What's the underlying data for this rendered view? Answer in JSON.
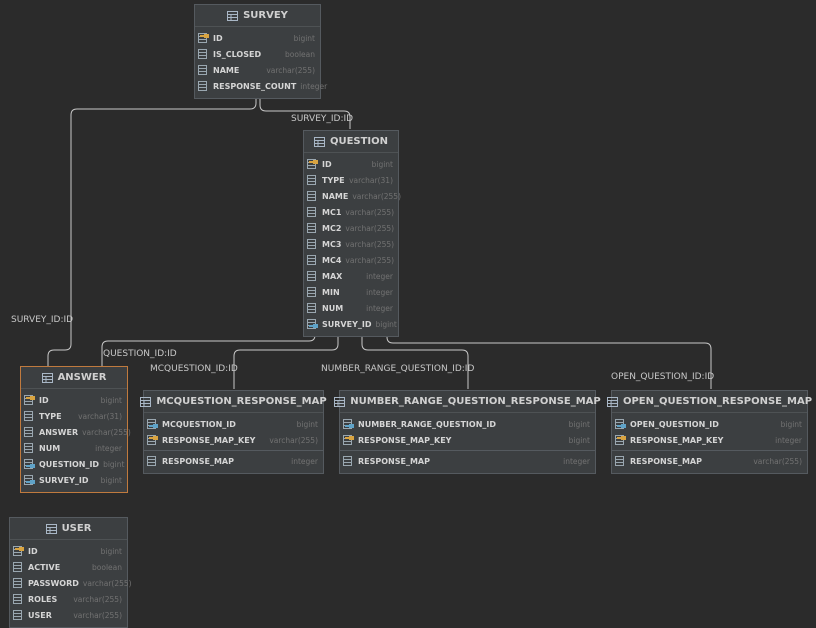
{
  "tables": {
    "survey": {
      "name": "SURVEY",
      "columns": [
        {
          "name": "ID",
          "type": "bigint",
          "icon": "primary-key-column-icon"
        },
        {
          "name": "IS_CLOSED",
          "type": "boolean",
          "icon": "column-icon"
        },
        {
          "name": "NAME",
          "type": "varchar(255)",
          "icon": "column-icon"
        },
        {
          "name": "RESPONSE_COUNT",
          "type": "integer",
          "icon": "column-icon"
        }
      ]
    },
    "question": {
      "name": "QUESTION",
      "columns": [
        {
          "name": "ID",
          "type": "bigint",
          "icon": "primary-key-column-icon"
        },
        {
          "name": "TYPE",
          "type": "varchar(31)",
          "icon": "column-icon"
        },
        {
          "name": "NAME",
          "type": "varchar(255)",
          "icon": "column-icon"
        },
        {
          "name": "MC1",
          "type": "varchar(255)",
          "icon": "column-icon"
        },
        {
          "name": "MC2",
          "type": "varchar(255)",
          "icon": "column-icon"
        },
        {
          "name": "MC3",
          "type": "varchar(255)",
          "icon": "column-icon"
        },
        {
          "name": "MC4",
          "type": "varchar(255)",
          "icon": "column-icon"
        },
        {
          "name": "MAX",
          "type": "integer",
          "icon": "column-icon"
        },
        {
          "name": "MIN",
          "type": "integer",
          "icon": "column-icon"
        },
        {
          "name": "NUM",
          "type": "integer",
          "icon": "column-icon"
        },
        {
          "name": "SURVEY_ID",
          "type": "bigint",
          "icon": "foreign-key-column-icon"
        }
      ]
    },
    "answer": {
      "name": "ANSWER",
      "columns": [
        {
          "name": "ID",
          "type": "bigint",
          "icon": "primary-key-column-icon"
        },
        {
          "name": "TYPE",
          "type": "varchar(31)",
          "icon": "column-icon"
        },
        {
          "name": "ANSWER",
          "type": "varchar(255)",
          "icon": "column-icon"
        },
        {
          "name": "NUM",
          "type": "integer",
          "icon": "column-icon"
        },
        {
          "name": "QUESTION_ID",
          "type": "bigint",
          "icon": "foreign-key-column-icon"
        },
        {
          "name": "SURVEY_ID",
          "type": "bigint",
          "icon": "foreign-key-column-icon"
        }
      ]
    },
    "mcq_map": {
      "name": "MCQUESTION_RESPONSE_MAP",
      "columns": [
        {
          "name": "MCQUESTION_ID",
          "type": "bigint",
          "icon": "foreign-key-column-icon"
        },
        {
          "name": "RESPONSE_MAP_KEY",
          "type": "varchar(255)",
          "icon": "primary-key-column-icon"
        }
      ],
      "extra": [
        {
          "name": "RESPONSE_MAP",
          "type": "integer",
          "icon": "column-icon"
        }
      ]
    },
    "nrq_map": {
      "name": "NUMBER_RANGE_QUESTION_RESPONSE_MAP",
      "columns": [
        {
          "name": "NUMBER_RANGE_QUESTION_ID",
          "type": "bigint",
          "icon": "foreign-key-column-icon"
        },
        {
          "name": "RESPONSE_MAP_KEY",
          "type": "bigint",
          "icon": "primary-key-column-icon"
        }
      ],
      "extra": [
        {
          "name": "RESPONSE_MAP",
          "type": "integer",
          "icon": "column-icon"
        }
      ]
    },
    "oq_map": {
      "name": "OPEN_QUESTION_RESPONSE_MAP",
      "columns": [
        {
          "name": "OPEN_QUESTION_ID",
          "type": "bigint",
          "icon": "foreign-key-column-icon"
        },
        {
          "name": "RESPONSE_MAP_KEY",
          "type": "integer",
          "icon": "primary-key-column-icon"
        }
      ],
      "extra": [
        {
          "name": "RESPONSE_MAP",
          "type": "varchar(255)",
          "icon": "column-icon"
        }
      ]
    },
    "user": {
      "name": "USER",
      "columns": [
        {
          "name": "ID",
          "type": "bigint",
          "icon": "primary-key-column-icon"
        },
        {
          "name": "ACTIVE",
          "type": "boolean",
          "icon": "column-icon"
        },
        {
          "name": "PASSWORD",
          "type": "varchar(255)",
          "icon": "column-icon"
        },
        {
          "name": "ROLES",
          "type": "varchar(255)",
          "icon": "column-icon"
        },
        {
          "name": "USER",
          "type": "varchar(255)",
          "icon": "column-icon"
        }
      ]
    }
  },
  "relations": [
    {
      "id": "question-survey",
      "label": "SURVEY_ID:ID"
    },
    {
      "id": "answer-survey",
      "label": "SURVEY_ID:ID"
    },
    {
      "id": "answer-question",
      "label": "QUESTION_ID:ID"
    },
    {
      "id": "mcq-question",
      "label": "MCQUESTION_ID:ID"
    },
    {
      "id": "nrq-question",
      "label": "NUMBER_RANGE_QUESTION_ID:ID"
    },
    {
      "id": "oq-question",
      "label": "OPEN_QUESTION_ID:ID"
    }
  ],
  "colors": {
    "background": "#2b2b2b",
    "table_bg": "#3c3f41",
    "selected_border": "#c07a3e",
    "edge": "#c8c8c8",
    "pk_key": "#d9a441",
    "fk_key": "#5fa3c8"
  }
}
